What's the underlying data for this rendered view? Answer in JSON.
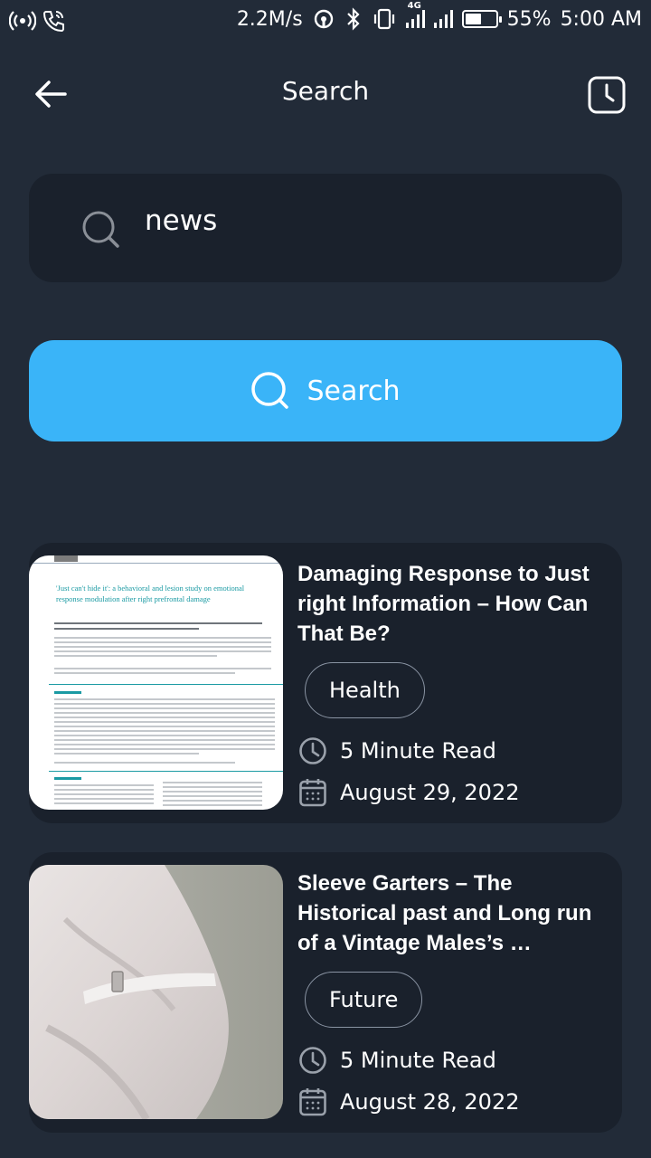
{
  "status_bar": {
    "speed": "2.2M/s",
    "network_badge": "4G",
    "battery_percent": "55%",
    "battery_level": 0.55,
    "time": "5:00 AM"
  },
  "header": {
    "title": "Search"
  },
  "search": {
    "value": "news"
  },
  "search_button": {
    "label": "Search"
  },
  "results": [
    {
      "title": "Damaging Response to Just right Information – How Can That Be?",
      "tag": "Health",
      "read_time": "5 Minute Read",
      "date": "August 29, 2022",
      "thumbnail": {
        "doc_title": "'Just can't hide it': a behavioral and lesion study on emotional response modulation after right prefrontal damage"
      }
    },
    {
      "title": "Sleeve Garters – The Historical past and Long run of a Vintage Males’s …",
      "tag": "Future",
      "read_time": "5 Minute Read",
      "date": "August 28, 2022"
    }
  ],
  "colors": {
    "background": "#222b38",
    "card": "#1a212c",
    "accent": "#3ab4f8"
  }
}
